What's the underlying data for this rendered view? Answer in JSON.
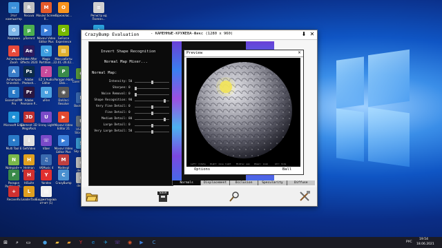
{
  "desktop": {
    "icons": [
      {
        "label": "Этот компьютер",
        "glyph": "▭",
        "color": "#3a8fd9"
      },
      {
        "label": "Recuva",
        "glyph": "R",
        "color": "#c0c0c0"
      },
      {
        "label": "Movavi Screen R...",
        "glyph": "M",
        "color": "#e55a2b"
      },
      {
        "label": "Одноклас...",
        "glyph": "О",
        "color": "#f7931e"
      },
      {
        "label": "Регистр ид Полезн...",
        "glyph": "≡",
        "color": "#d0d0d0"
      },
      {
        "label": "Корзина",
        "glyph": "♻",
        "color": "#7fb6e8"
      },
      {
        "label": "µTorrent",
        "glyph": "µ",
        "color": "#4caf50"
      },
      {
        "label": "Movavi Video Editor Plus",
        "glyph": "▶",
        "color": "#3b7dd8"
      },
      {
        "label": "GeForce Experience",
        "glyph": "G",
        "color": "#76b900"
      },
      {
        "label": "Telegram",
        "glyph": "✈",
        "color": "#2aa3e0"
      },
      {
        "label": "Ashampoo Zoom",
        "glyph": "A",
        "color": "#e84a3c"
      },
      {
        "label": "Adobe After Effects 2020",
        "glyph": "Ae",
        "color": "#2a1a5e"
      },
      {
        "label": "Magic Partition...",
        "glyph": "◔",
        "color": "#3c9de0"
      },
      {
        "label": "Мои работы 22.01.-26.02...",
        "glyph": "▤",
        "color": "#e0b030"
      },
      {
        "label": "Ashampoo Uninstall...",
        "glyph": "A",
        "color": "#3a7dc8"
      },
      {
        "label": "Adobe Photosh...",
        "glyph": "Ps",
        "color": "#0c2b4a"
      },
      {
        "label": "EZ 3 Audio Editor",
        "glyph": "♪",
        "color": "#c94b9c"
      },
      {
        "label": "Paragon Hard Disk...",
        "glyph": "P",
        "color": "#3a8a4a"
      },
      {
        "label": "EssentialPIM Pro",
        "glyph": "E",
        "color": "#2a7ac8"
      },
      {
        "label": "Adobe Premiere P...",
        "glyph": "Pr",
        "color": "#2a1640"
      },
      {
        "label": "uFiler",
        "glyph": "u",
        "color": "#4aa0e0"
      },
      {
        "label": "DaVinci Resolve",
        "glyph": "◉",
        "color": "#5a5a5a"
      },
      {
        "label": "Microsoft Edge",
        "glyph": "e",
        "color": "#1e8fd6"
      },
      {
        "label": "Element 3D MegaPack",
        "glyph": "3D",
        "color": "#c03030"
      },
      {
        "label": "Unray Light",
        "glyph": "U",
        "color": "#7a4ac8"
      },
      {
        "label": "Movavi Video Editor 21",
        "glyph": "▶",
        "color": "#e24a30"
      },
      {
        "label": "Multi Tool 6",
        "glyph": "✦",
        "color": "#2a7ac8"
      },
      {
        "label": "GetVideo",
        "glyph": "↓",
        "color": "#e0e0e0"
      },
      {
        "label": "Viber",
        "glyph": "☏",
        "color": "#7a4ac8"
      },
      {
        "label": "Movavi Video Editor Plus",
        "glyph": "▶",
        "color": "#3b7dd8"
      },
      {
        "label": "Notepad++",
        "glyph": "N",
        "color": "#7ab84a"
      },
      {
        "label": "Helman Partition...",
        "glyph": "H",
        "color": "#e0a020"
      },
      {
        "label": "VKMusic 4",
        "glyph": "♫",
        "color": "#3a6ab0"
      },
      {
        "label": "Madexpl Dynasty",
        "glyph": "M",
        "color": "#c04040"
      },
      {
        "label": "Paragon Partition M...",
        "glyph": "P",
        "color": "#3a8a4a"
      },
      {
        "label": "HiSuite",
        "glyph": "H",
        "color": "#d03030"
      },
      {
        "label": "Yandex",
        "glyph": "Y",
        "color": "#e03030"
      },
      {
        "label": "CrazyBump",
        "glyph": "C",
        "color": "#4a90d0"
      },
      {
        "label": "RecoveRx",
        "glyph": "+",
        "color": "#d03030"
      },
      {
        "label": "LeaderTask",
        "glyph": "L",
        "color": "#e0a020"
      },
      {
        "label": "Бюджетирование отчет (1)",
        "glyph": "▤",
        "color": "#f0f0f0"
      }
    ],
    "extra_icons": [
      {
        "label": "Corel Video...",
        "glyph": "C",
        "color": "#5a9a3a"
      },
      {
        "label": "Bootcam...",
        "glyph": "B",
        "color": "#3a6ab0"
      },
      {
        "label": "USB Dis Storage...",
        "glyph": "U",
        "color": "#607080"
      },
      {
        "label": "Sky Lego...",
        "glyph": "S",
        "color": "#3a9ad0"
      },
      {
        "label": "desk...",
        "glyph": "d",
        "color": "#c0c0c0"
      },
      {
        "label": "desk...",
        "glyph": "d",
        "color": "#c0c0c0"
      }
    ]
  },
  "app": {
    "title": "CrazyBump Evaluation",
    "file": "- КАМЕННЫЕ-КРУЖЕВА-Фикс (1280 x 960)",
    "menu_invert": "Invert Shape Recognition",
    "menu_mixer": "Normal Map Mixer...",
    "section_label": "Normal Map:",
    "sliders": [
      {
        "name": "Intensity:",
        "value": "50",
        "pos": 0.5
      },
      {
        "name": "Sharpen:",
        "value": "0",
        "pos": 0.0
      },
      {
        "name": "Noise Removal:",
        "value": "0",
        "pos": 0.0
      },
      {
        "name": "Shape Recognition:",
        "value": "90",
        "pos": 0.9
      },
      {
        "name": "Very Fine Detail:",
        "value": "0",
        "pos": 0.5
      },
      {
        "name": "Fine Detail:",
        "value": "0",
        "pos": 0.5
      },
      {
        "name": "Medium Detail:",
        "value": "80",
        "pos": 0.9
      },
      {
        "name": "Large Detail:",
        "value": "0",
        "pos": 0.5
      },
      {
        "name": "Very Large Detail:",
        "value": "50",
        "pos": 0.5
      }
    ],
    "preview_title": "Preview",
    "preview_labels": [
      "Left: rotate",
      "Right: move light",
      "Middle: pan",
      "Wheel: zoom",
      "Alt: hide"
    ],
    "options_label": "Options",
    "ball_label": "Ball",
    "tabs": [
      "Normals",
      "Displacement",
      "Occlusion",
      "Specularity",
      "Diffuse"
    ],
    "active_tab": "Normals",
    "save_label": "Save"
  },
  "tray": {
    "lang": "РУС",
    "time": "19:54",
    "date": "18.06.2021"
  },
  "colors": {
    "accent": "#3a8fd9",
    "panel": "#0b0b0b"
  }
}
